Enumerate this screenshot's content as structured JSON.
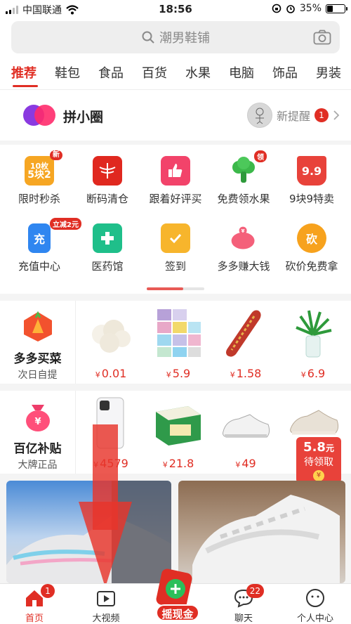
{
  "status_bar": {
    "carrier": "中国联通",
    "time": "18:56",
    "battery": "35%"
  },
  "search": {
    "placeholder": "潮男鞋铺"
  },
  "tabs": [
    "推荐",
    "鞋包",
    "食品",
    "百货",
    "水果",
    "电脑",
    "饰品",
    "男装"
  ],
  "circle": {
    "title": "拼小圈",
    "reminder_label": "新提醒",
    "reminder_count": "1"
  },
  "grid": [
    {
      "label": "限时秒杀",
      "icon": "flash-sale-icon",
      "art": "10枚\n5块2",
      "badge": "新"
    },
    {
      "label": "断码清仓",
      "icon": "clearance-icon",
      "art": "红蜻蜓"
    },
    {
      "label": "跟着好评买",
      "icon": "thumbs-up-icon"
    },
    {
      "label": "免费领水果",
      "icon": "broccoli-icon",
      "badge": "领"
    },
    {
      "label": "9块9特卖",
      "icon": "nine-nine-icon",
      "art": "9.9"
    },
    {
      "label": "充值中心",
      "icon": "recharge-icon",
      "art": "充",
      "badge": "立减2元"
    },
    {
      "label": "医药馆",
      "icon": "medicine-icon"
    },
    {
      "label": "签到",
      "icon": "calendar-check-icon"
    },
    {
      "label": "多多赚大钱",
      "icon": "piggy-bank-icon"
    },
    {
      "label": "砍价免费拿",
      "icon": "bargain-icon",
      "art": "砍"
    }
  ],
  "row_grocery": {
    "title": "多多买菜",
    "subtitle": "次日自提",
    "items": [
      {
        "name": "cauliflower-mushroom",
        "price": "0.01"
      },
      {
        "name": "shoe-storage-boxes",
        "price": "5.9"
      },
      {
        "name": "sausage",
        "price": "1.58"
      },
      {
        "name": "lucky-bamboo",
        "price": "6.9"
      }
    ]
  },
  "row_subsidy": {
    "title": "百亿补贴",
    "subtitle": "大牌正品",
    "items": [
      {
        "name": "iphone",
        "price": "4579"
      },
      {
        "name": "milk-box",
        "price": "21.8"
      },
      {
        "name": "white-sneaker",
        "price": "49"
      },
      {
        "name": "boost-sneaker",
        "price": ""
      }
    ]
  },
  "currency": "¥",
  "coupon": {
    "amount": "5.8",
    "unit": "元",
    "label": "待领取",
    "coin": "¥"
  },
  "bottom_nav": [
    {
      "label": "首页",
      "icon": "home-icon",
      "badge": "1"
    },
    {
      "label": "大视频",
      "icon": "video-icon"
    },
    {
      "label": "摇现金",
      "icon": "shake-cash-icon"
    },
    {
      "label": "聊天",
      "icon": "chat-icon",
      "badge": "22"
    },
    {
      "label": "个人中心",
      "icon": "profile-icon"
    }
  ],
  "colors": {
    "accent": "#e02e24",
    "background": "#f4f4f4"
  }
}
